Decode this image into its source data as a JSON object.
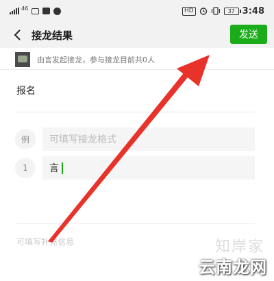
{
  "status_bar": {
    "left_label": "46",
    "hd_label": "HD",
    "battery_level": "37",
    "time": "3:48"
  },
  "nav": {
    "title": "接龙结果",
    "send_label": "发送"
  },
  "initiator": {
    "text": "由言发起接龙，参与接龙目前共0人"
  },
  "form": {
    "signup_label": "报名",
    "example_badge": "例",
    "example_placeholder": "可填写接龙格式",
    "entry_badge": "1",
    "entry_value": "言",
    "supplement_placeholder": "可填写补充信息"
  },
  "watermark": {
    "top": "知岸家",
    "bottom": "云南龙网"
  },
  "colors": {
    "accent": "#1aad19",
    "arrow": "#e8332a"
  }
}
